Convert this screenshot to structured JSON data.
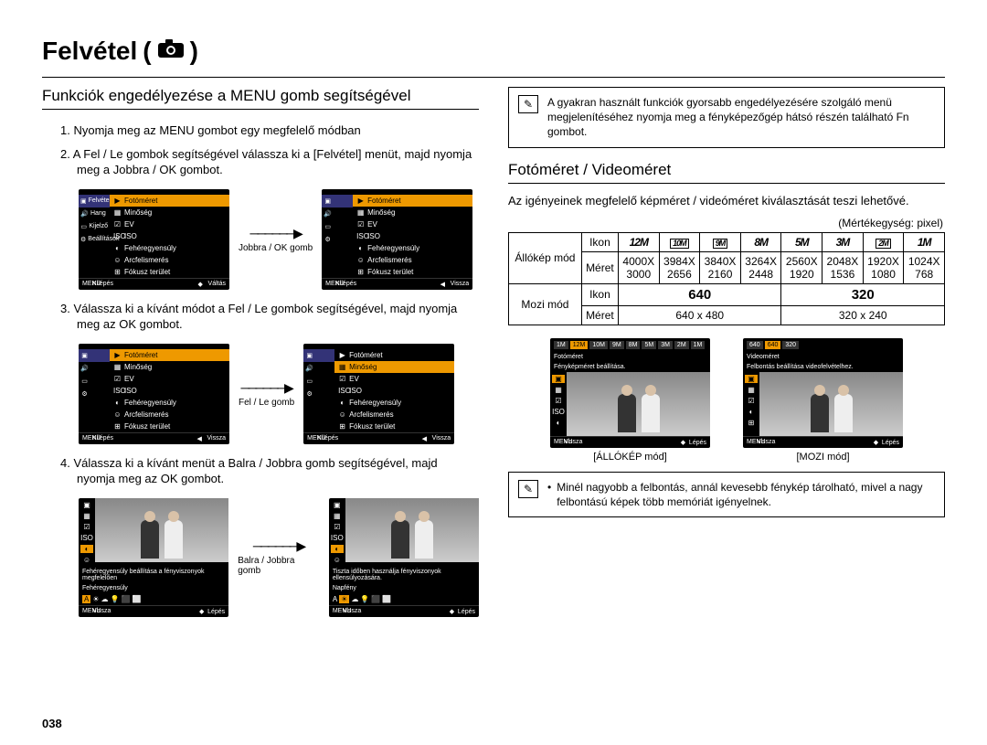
{
  "page_number": "038",
  "title": "Felvétel",
  "left": {
    "section_head": "Funkciók engedélyezése a MENU gomb segítségével",
    "step1": "1. Nyomja meg az MENU gombot egy megfelelő módban",
    "step2": "2. A Fel / Le gombok segítségével válassza ki a [Felvétel] menüt, majd nyomja meg a Jobbra / OK gombot.",
    "step3": "3. Válassza ki a kívánt módot a Fel / Le gombok segítségével, majd nyomja meg az OK gombot.",
    "step4": "4. Válassza ki a kívánt menüt a Balra / Jobbra gomb segítségével, majd nyomja meg az OK gombot.",
    "arrow1": "Jobbra / OK gomb",
    "arrow2": "Fel / Le gomb",
    "arrow3": "Balra / Jobbra gomb",
    "menu_tabs": [
      "Felvétel",
      "Hang",
      "Kijelző",
      "Beállítások"
    ],
    "menu_items": [
      "Fotóméret",
      "Minőség",
      "EV",
      "ISO",
      "Fehéregyensúly",
      "Arcfelismerés",
      "Fókusz terület"
    ],
    "menu_exit": "Kilépés",
    "menu_shift": "Váltás",
    "menu_back": "Vissza",
    "wb_caption1": "Fehéregyensúly beállítása a fényviszonyok megfelelően",
    "wb_caption1b": "Fehéregyensúly",
    "wb_caption2": "Tiszta időben használja fényviszonyok ellensúlyozására.",
    "wb_caption2b": "Napfény",
    "step_icon": "Lépés"
  },
  "right": {
    "callout_text": "A gyakran használt funkciók gyorsabb engedélyezésére szolgáló menü megjelenítéséhez nyomja meg a fényképezőgép hátsó részén található Fn gombot.",
    "section_head": "Fotóméret / Videoméret",
    "intro": "Az igényeinek megfelelő képméret / videóméret kiválasztását teszi lehetővé.",
    "unit": "(Mértékegység: pixel)",
    "table": {
      "still_label": "Állókép mód",
      "movie_label": "Mozi mód",
      "col_icon": "Ikon",
      "col_size": "Méret",
      "still_icons": [
        "12M",
        "10M",
        "9M",
        "8M",
        "5M",
        "3M",
        "2M",
        "1M"
      ],
      "still_sizes_top": [
        "4000X",
        "3984X",
        "3840X",
        "3264X",
        "2560X",
        "2048X",
        "1920X",
        "1024X"
      ],
      "still_sizes_bot": [
        "3000",
        "2656",
        "2160",
        "2448",
        "1920",
        "1536",
        "1080",
        "768"
      ],
      "movie_icons": [
        "640",
        "320"
      ],
      "movie_sizes": [
        "640 x 480",
        "320 x 240"
      ]
    },
    "mode_fig_left": "[ÁLLÓKÉP mód]",
    "mode_fig_right": "[MOZI mód]",
    "still_preview": {
      "caption1": "Fotóméret",
      "caption2": "Fényképméret beállítása."
    },
    "movie_preview": {
      "bar": [
        "640",
        "640",
        "320"
      ],
      "caption1": "Videoméret",
      "caption2": "Felbontás beállítása videofelvételhez."
    },
    "callout2_text": "Minél nagyobb a felbontás, annál kevesebb fénykép tárolható, mivel a nagy felbontású képek több memóriát igényelnek."
  }
}
